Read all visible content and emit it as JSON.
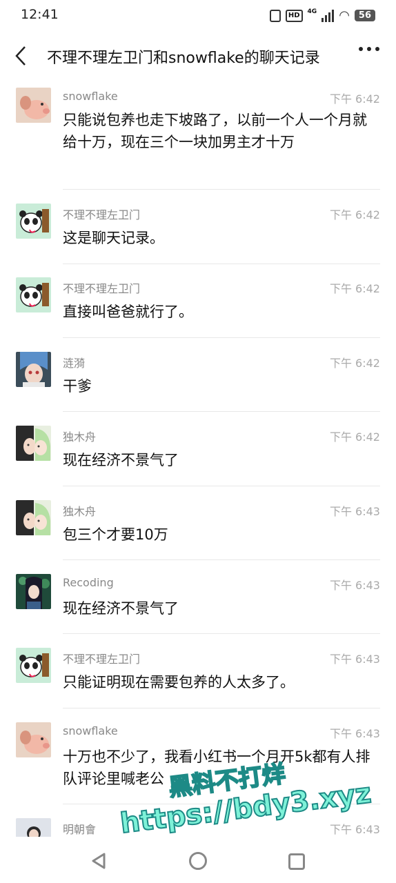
{
  "status_bar": {
    "time": "12:41",
    "network": "4G",
    "battery": "56"
  },
  "header": {
    "title": "不理不理左卫门和snowflake的聊天记录"
  },
  "messages": [
    {
      "sender": "snowflake",
      "time": "下午 6:42",
      "text": "只能说包养也走下坡路了，以前一个人一个月就给十万，现在三个一块加男主才十万",
      "avatar": "pig-avatar"
    },
    {
      "sender": "不理不理左卫门",
      "time": "下午 6:42",
      "text": "这是聊天记录。",
      "avatar": "panda-avatar"
    },
    {
      "sender": "不理不理左卫门",
      "time": "下午 6:42",
      "text": "直接叫爸爸就行了。",
      "avatar": "panda-avatar"
    },
    {
      "sender": "涟漪",
      "time": "下午 6:42",
      "text": "干爹",
      "avatar": "anime-blue-hair-avatar"
    },
    {
      "sender": "独木舟",
      "time": "下午 6:42",
      "text": "现在经济不景气了",
      "avatar": "anime-couple-avatar"
    },
    {
      "sender": "独木舟",
      "time": "下午 6:43",
      "text": "包三个才要10万",
      "avatar": "anime-couple-avatar"
    },
    {
      "sender": "Recoding",
      "time": "下午 6:43",
      "text": "现在经济不景气了",
      "avatar": "anime-girl-avatar"
    },
    {
      "sender": "不理不理左卫门",
      "time": "下午 6:43",
      "text": "只能证明现在需要包养的人太多了。",
      "avatar": "panda-avatar"
    },
    {
      "sender": "snowflake",
      "time": "下午 6:43",
      "text": "十万也不少了，我看小红书一个月开5k都有人排队评论里喊老公",
      "avatar": "pig-avatar"
    },
    {
      "sender": "明朝會",
      "time": "下午 6:43",
      "text": "",
      "avatar": "person-avatar"
    }
  ],
  "watermark": {
    "line1": "黑料不打烊",
    "line2": "https://bdy3.xyz"
  },
  "colors": {
    "name": "#888888",
    "time": "#aaaaaa",
    "divider": "#e8e8e8",
    "watermark": "#7ef2d8"
  }
}
